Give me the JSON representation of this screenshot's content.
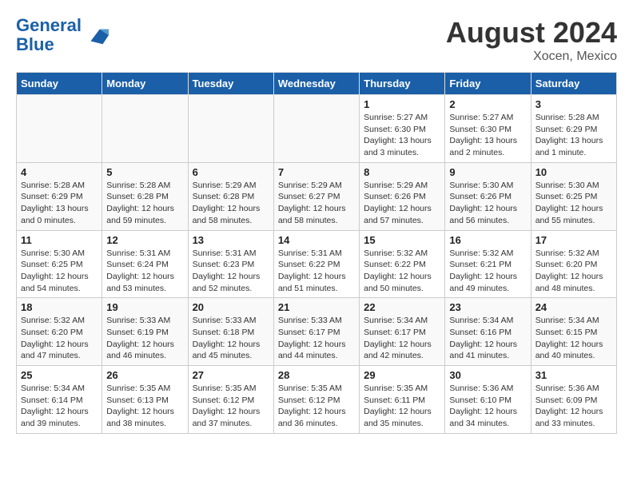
{
  "header": {
    "logo_line1": "General",
    "logo_line2": "Blue",
    "month": "August 2024",
    "location": "Xocen, Mexico"
  },
  "weekdays": [
    "Sunday",
    "Monday",
    "Tuesday",
    "Wednesday",
    "Thursday",
    "Friday",
    "Saturday"
  ],
  "weeks": [
    [
      {
        "day": "",
        "info": ""
      },
      {
        "day": "",
        "info": ""
      },
      {
        "day": "",
        "info": ""
      },
      {
        "day": "",
        "info": ""
      },
      {
        "day": "1",
        "info": "Sunrise: 5:27 AM\nSunset: 6:30 PM\nDaylight: 13 hours\nand 3 minutes."
      },
      {
        "day": "2",
        "info": "Sunrise: 5:27 AM\nSunset: 6:30 PM\nDaylight: 13 hours\nand 2 minutes."
      },
      {
        "day": "3",
        "info": "Sunrise: 5:28 AM\nSunset: 6:29 PM\nDaylight: 13 hours\nand 1 minute."
      }
    ],
    [
      {
        "day": "4",
        "info": "Sunrise: 5:28 AM\nSunset: 6:29 PM\nDaylight: 13 hours\nand 0 minutes."
      },
      {
        "day": "5",
        "info": "Sunrise: 5:28 AM\nSunset: 6:28 PM\nDaylight: 12 hours\nand 59 minutes."
      },
      {
        "day": "6",
        "info": "Sunrise: 5:29 AM\nSunset: 6:28 PM\nDaylight: 12 hours\nand 58 minutes."
      },
      {
        "day": "7",
        "info": "Sunrise: 5:29 AM\nSunset: 6:27 PM\nDaylight: 12 hours\nand 58 minutes."
      },
      {
        "day": "8",
        "info": "Sunrise: 5:29 AM\nSunset: 6:26 PM\nDaylight: 12 hours\nand 57 minutes."
      },
      {
        "day": "9",
        "info": "Sunrise: 5:30 AM\nSunset: 6:26 PM\nDaylight: 12 hours\nand 56 minutes."
      },
      {
        "day": "10",
        "info": "Sunrise: 5:30 AM\nSunset: 6:25 PM\nDaylight: 12 hours\nand 55 minutes."
      }
    ],
    [
      {
        "day": "11",
        "info": "Sunrise: 5:30 AM\nSunset: 6:25 PM\nDaylight: 12 hours\nand 54 minutes."
      },
      {
        "day": "12",
        "info": "Sunrise: 5:31 AM\nSunset: 6:24 PM\nDaylight: 12 hours\nand 53 minutes."
      },
      {
        "day": "13",
        "info": "Sunrise: 5:31 AM\nSunset: 6:23 PM\nDaylight: 12 hours\nand 52 minutes."
      },
      {
        "day": "14",
        "info": "Sunrise: 5:31 AM\nSunset: 6:22 PM\nDaylight: 12 hours\nand 51 minutes."
      },
      {
        "day": "15",
        "info": "Sunrise: 5:32 AM\nSunset: 6:22 PM\nDaylight: 12 hours\nand 50 minutes."
      },
      {
        "day": "16",
        "info": "Sunrise: 5:32 AM\nSunset: 6:21 PM\nDaylight: 12 hours\nand 49 minutes."
      },
      {
        "day": "17",
        "info": "Sunrise: 5:32 AM\nSunset: 6:20 PM\nDaylight: 12 hours\nand 48 minutes."
      }
    ],
    [
      {
        "day": "18",
        "info": "Sunrise: 5:32 AM\nSunset: 6:20 PM\nDaylight: 12 hours\nand 47 minutes."
      },
      {
        "day": "19",
        "info": "Sunrise: 5:33 AM\nSunset: 6:19 PM\nDaylight: 12 hours\nand 46 minutes."
      },
      {
        "day": "20",
        "info": "Sunrise: 5:33 AM\nSunset: 6:18 PM\nDaylight: 12 hours\nand 45 minutes."
      },
      {
        "day": "21",
        "info": "Sunrise: 5:33 AM\nSunset: 6:17 PM\nDaylight: 12 hours\nand 44 minutes."
      },
      {
        "day": "22",
        "info": "Sunrise: 5:34 AM\nSunset: 6:17 PM\nDaylight: 12 hours\nand 42 minutes."
      },
      {
        "day": "23",
        "info": "Sunrise: 5:34 AM\nSunset: 6:16 PM\nDaylight: 12 hours\nand 41 minutes."
      },
      {
        "day": "24",
        "info": "Sunrise: 5:34 AM\nSunset: 6:15 PM\nDaylight: 12 hours\nand 40 minutes."
      }
    ],
    [
      {
        "day": "25",
        "info": "Sunrise: 5:34 AM\nSunset: 6:14 PM\nDaylight: 12 hours\nand 39 minutes."
      },
      {
        "day": "26",
        "info": "Sunrise: 5:35 AM\nSunset: 6:13 PM\nDaylight: 12 hours\nand 38 minutes."
      },
      {
        "day": "27",
        "info": "Sunrise: 5:35 AM\nSunset: 6:12 PM\nDaylight: 12 hours\nand 37 minutes."
      },
      {
        "day": "28",
        "info": "Sunrise: 5:35 AM\nSunset: 6:12 PM\nDaylight: 12 hours\nand 36 minutes."
      },
      {
        "day": "29",
        "info": "Sunrise: 5:35 AM\nSunset: 6:11 PM\nDaylight: 12 hours\nand 35 minutes."
      },
      {
        "day": "30",
        "info": "Sunrise: 5:36 AM\nSunset: 6:10 PM\nDaylight: 12 hours\nand 34 minutes."
      },
      {
        "day": "31",
        "info": "Sunrise: 5:36 AM\nSunset: 6:09 PM\nDaylight: 12 hours\nand 33 minutes."
      }
    ]
  ]
}
